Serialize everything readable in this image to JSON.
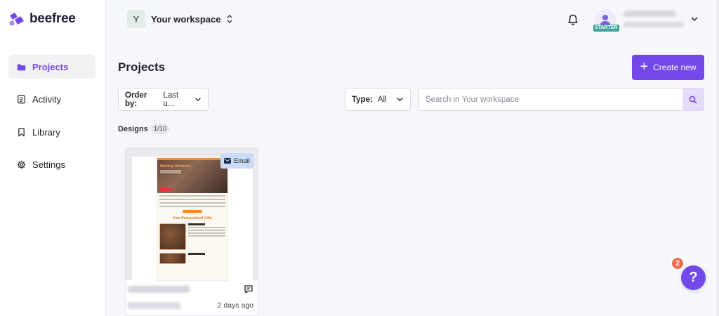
{
  "brand": {
    "name": "beefree",
    "accent": "#7248e8"
  },
  "sidebar": {
    "items": [
      {
        "label": "Projects",
        "icon": "folder-icon",
        "active": true
      },
      {
        "label": "Activity",
        "icon": "activity-icon",
        "active": false
      },
      {
        "label": "Library",
        "icon": "bookmark-icon",
        "active": false
      },
      {
        "label": "Settings",
        "icon": "gear-icon",
        "active": false
      }
    ]
  },
  "header": {
    "workspace_initial": "Y",
    "workspace_name": "Your workspace",
    "user_plan_badge": "STARTER"
  },
  "main": {
    "title": "Projects",
    "create_label": "Create new",
    "order": {
      "label": "Order by:",
      "value": "Last u..."
    },
    "type": {
      "label": "Type:",
      "value": "All"
    },
    "search": {
      "placeholder": "Search in Your workspace"
    },
    "designs": {
      "label": "Designs",
      "count": "1/10"
    }
  },
  "cards": [
    {
      "type_badge": "Email",
      "time": "2 days ago",
      "preview": {
        "hero_title": "Holiday Moment",
        "section_title": "Your Personalized Gifts"
      }
    }
  ],
  "help": {
    "label": "?",
    "notifications": "2"
  }
}
